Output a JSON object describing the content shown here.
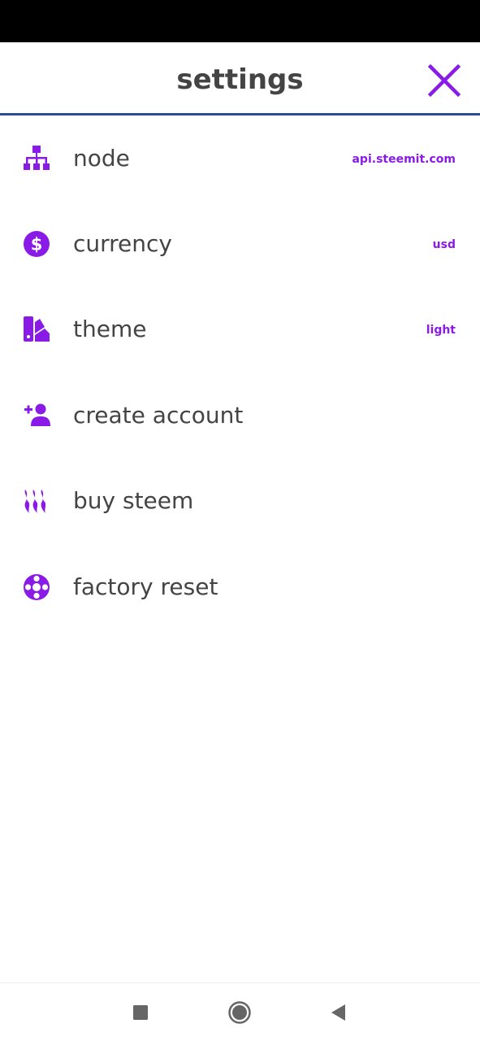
{
  "header": {
    "title": "settings",
    "close_icon": "close-icon"
  },
  "colors": {
    "accent": "#8a1be6",
    "divider": "#2a4d8f",
    "text": "#444444"
  },
  "settings": [
    {
      "label": "node",
      "value": "api.steemit.com",
      "icon": "sitemap-icon"
    },
    {
      "label": "currency",
      "value": "usd",
      "icon": "dollar-circle-icon"
    },
    {
      "label": "theme",
      "value": "light",
      "icon": "swatchbook-icon"
    },
    {
      "label": "create account",
      "value": "",
      "icon": "user-plus-icon"
    },
    {
      "label": "buy steem",
      "value": "",
      "icon": "steem-icon"
    },
    {
      "label": "factory reset",
      "value": "",
      "icon": "life-ring-icon"
    }
  ],
  "nav": {
    "recents_icon": "square-icon",
    "home_icon": "circle-home-icon",
    "back_icon": "back-triangle-icon"
  }
}
